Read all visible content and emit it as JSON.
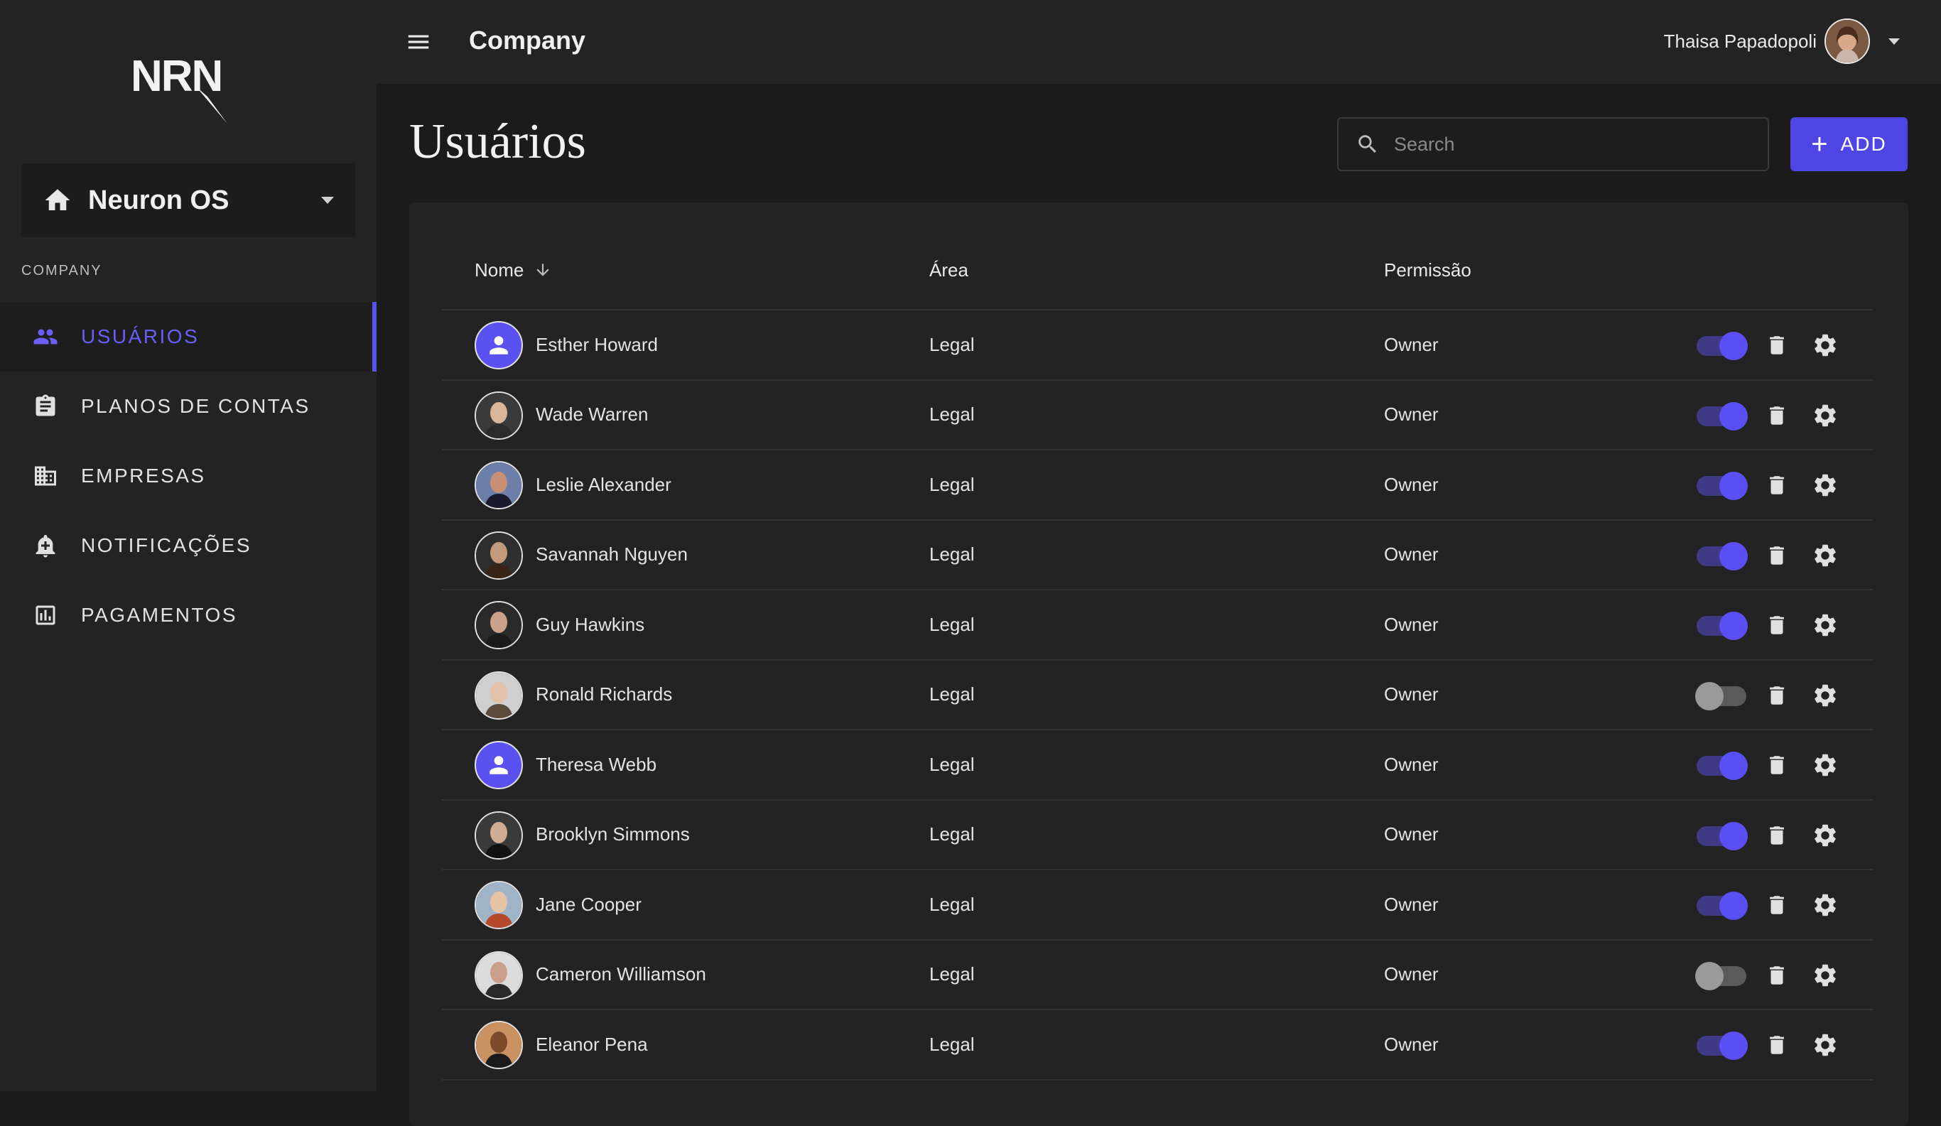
{
  "brand": {
    "logo_text": "NRN"
  },
  "workspace": {
    "label": "Neuron OS"
  },
  "sidebar": {
    "section_label": "COMPANY",
    "items": [
      {
        "label": "USUÁRIOS",
        "icon": "people-icon",
        "active": true
      },
      {
        "label": "PLANOS DE CONTAS",
        "icon": "clipboard-icon",
        "active": false
      },
      {
        "label": "EMPRESAS",
        "icon": "building-icon",
        "active": false
      },
      {
        "label": "NOTIFICAÇÕES",
        "icon": "bell-icon",
        "active": false
      },
      {
        "label": "PAGAMENTOS",
        "icon": "chart-icon",
        "active": false
      }
    ]
  },
  "header": {
    "title": "Company",
    "user_name": "Thaisa Papadopoli"
  },
  "page": {
    "title": "Usuários",
    "search_placeholder": "Search",
    "add_label": "ADD"
  },
  "table": {
    "columns": {
      "name": "Nome",
      "area": "Área",
      "permission": "Permissão"
    },
    "rows": [
      {
        "name": "Esther Howard",
        "area": "Legal",
        "permission": "Owner",
        "active": true,
        "avatar": "placeholder"
      },
      {
        "name": "Wade Warren",
        "area": "Legal",
        "permission": "Owner",
        "active": true,
        "avatar": "photo"
      },
      {
        "name": "Leslie Alexander",
        "area": "Legal",
        "permission": "Owner",
        "active": true,
        "avatar": "photo"
      },
      {
        "name": "Savannah Nguyen",
        "area": "Legal",
        "permission": "Owner",
        "active": true,
        "avatar": "photo"
      },
      {
        "name": "Guy Hawkins",
        "area": "Legal",
        "permission": "Owner",
        "active": true,
        "avatar": "photo"
      },
      {
        "name": "Ronald Richards",
        "area": "Legal",
        "permission": "Owner",
        "active": false,
        "avatar": "photo"
      },
      {
        "name": "Theresa Webb",
        "area": "Legal",
        "permission": "Owner",
        "active": true,
        "avatar": "placeholder"
      },
      {
        "name": "Brooklyn Simmons",
        "area": "Legal",
        "permission": "Owner",
        "active": true,
        "avatar": "photo"
      },
      {
        "name": "Jane Cooper",
        "area": "Legal",
        "permission": "Owner",
        "active": true,
        "avatar": "photo"
      },
      {
        "name": "Cameron Williamson",
        "area": "Legal",
        "permission": "Owner",
        "active": false,
        "avatar": "photo"
      },
      {
        "name": "Eleanor Pena",
        "area": "Legal",
        "permission": "Owner",
        "active": true,
        "avatar": "photo"
      }
    ]
  },
  "colors": {
    "accent": "#5b50f0",
    "background": "#1b1b1b",
    "panel": "#232323"
  }
}
